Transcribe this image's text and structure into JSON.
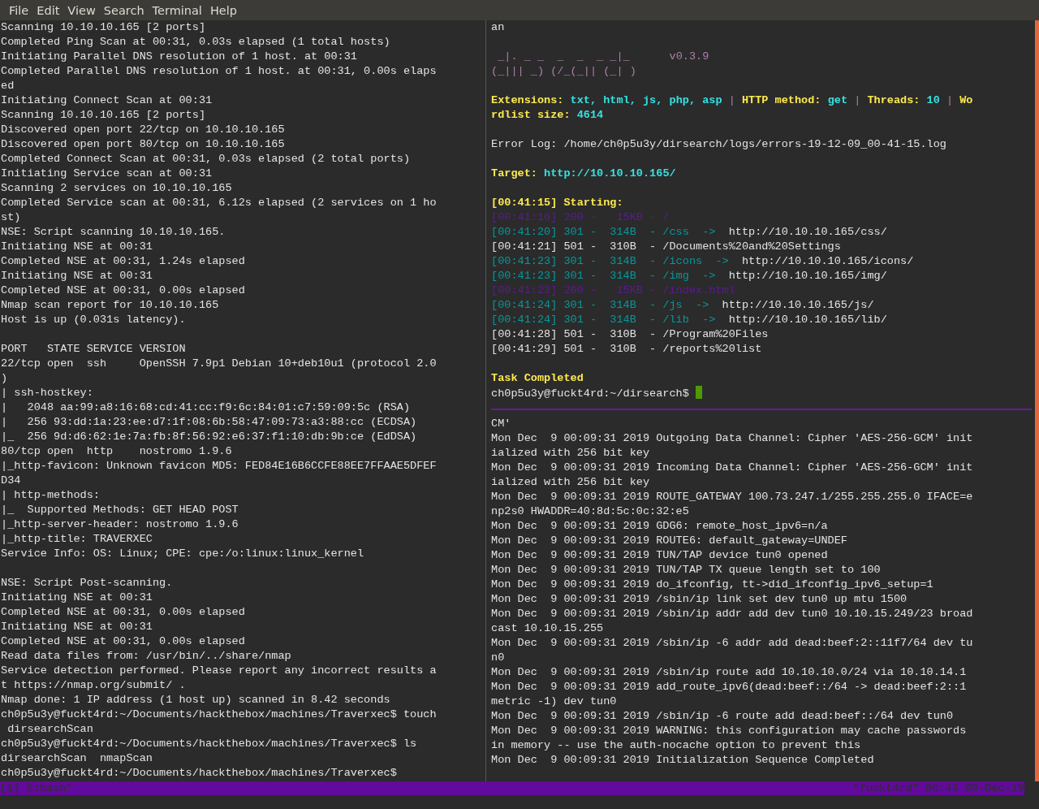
{
  "menu": [
    "File",
    "Edit",
    "View",
    "Search",
    "Terminal",
    "Help"
  ],
  "left_pane": {
    "lines": [
      [
        {
          "text": "Scanning 10.10.10.165 [2 ports]",
          "kind": "plain"
        }
      ],
      [
        {
          "text": "Completed Ping Scan at 00:31, 0.03s elapsed (1 total hosts)",
          "kind": "plain"
        }
      ],
      [
        {
          "text": "Initiating Parallel DNS resolution of 1 host. at 00:31",
          "kind": "plain"
        }
      ],
      [
        {
          "text": "Completed Parallel DNS resolution of 1 host. at 00:31, 0.00s elaps",
          "kind": "plain"
        }
      ],
      [
        {
          "text": "ed",
          "kind": "plain"
        }
      ],
      [
        {
          "text": "Initiating Connect Scan at 00:31",
          "kind": "plain"
        }
      ],
      [
        {
          "text": "Scanning 10.10.10.165 [2 ports]",
          "kind": "plain"
        }
      ],
      [
        {
          "text": "Discovered open port 22/tcp on 10.10.10.165",
          "kind": "plain"
        }
      ],
      [
        {
          "text": "Discovered open port 80/tcp on 10.10.10.165",
          "kind": "plain"
        }
      ],
      [
        {
          "text": "Completed Connect Scan at 00:31, 0.03s elapsed (2 total ports)",
          "kind": "plain"
        }
      ],
      [
        {
          "text": "Initiating Service scan at 00:31",
          "kind": "plain"
        }
      ],
      [
        {
          "text": "Scanning 2 services on 10.10.10.165",
          "kind": "plain"
        }
      ],
      [
        {
          "text": "Completed Service scan at 00:31, 6.12s elapsed (2 services on 1 ho",
          "kind": "plain"
        }
      ],
      [
        {
          "text": "st)",
          "kind": "plain"
        }
      ],
      [
        {
          "text": "NSE: Script scanning 10.10.10.165.",
          "kind": "plain"
        }
      ],
      [
        {
          "text": "Initiating NSE at 00:31",
          "kind": "plain"
        }
      ],
      [
        {
          "text": "Completed NSE at 00:31, 1.24s elapsed",
          "kind": "plain"
        }
      ],
      [
        {
          "text": "Initiating NSE at 00:31",
          "kind": "plain"
        }
      ],
      [
        {
          "text": "Completed NSE at 00:31, 0.00s elapsed",
          "kind": "plain"
        }
      ],
      [
        {
          "text": "Nmap scan report for 10.10.10.165",
          "kind": "plain"
        }
      ],
      [
        {
          "text": "Host is up (0.031s latency).",
          "kind": "plain"
        }
      ],
      {
        "kind": "blank"
      },
      [
        {
          "text": "PORT   STATE SERVICE VERSION",
          "kind": "plain"
        }
      ],
      [
        {
          "text": "22/tcp open  ssh     OpenSSH 7.9p1 Debian 10+deb10u1 (protocol 2.0",
          "kind": "plain"
        }
      ],
      [
        {
          "text": ")",
          "kind": "plain"
        }
      ],
      [
        {
          "text": "| ssh-hostkey:",
          "kind": "plain"
        }
      ],
      [
        {
          "text": "|   2048 aa:99:a8:16:68:cd:41:cc:f9:6c:84:01:c7:59:09:5c (RSA)",
          "kind": "plain"
        }
      ],
      [
        {
          "text": "|   256 93:dd:1a:23:ee:d7:1f:08:6b:58:47:09:73:a3:88:cc (ECDSA)",
          "kind": "plain"
        }
      ],
      [
        {
          "text": "|_  256 9d:d6:62:1e:7a:fb:8f:56:92:e6:37:f1:10:db:9b:ce (EdDSA)",
          "kind": "plain"
        }
      ],
      [
        {
          "text": "80/tcp open  http    nostromo 1.9.6",
          "kind": "plain"
        }
      ],
      [
        {
          "text": "|_http-favicon: Unknown favicon MD5: FED84E16B6CCFE88EE7FFAAE5DFEF",
          "kind": "plain"
        }
      ],
      [
        {
          "text": "D34",
          "kind": "plain"
        }
      ],
      [
        {
          "text": "| http-methods:",
          "kind": "plain"
        }
      ],
      [
        {
          "text": "|_  Supported Methods: GET HEAD POST",
          "kind": "plain"
        }
      ],
      [
        {
          "text": "|_http-server-header: nostromo 1.9.6",
          "kind": "plain"
        }
      ],
      [
        {
          "text": "|_http-title: TRAVERXEC",
          "kind": "plain"
        }
      ],
      [
        {
          "text": "Service Info: OS: Linux; CPE: cpe:/o:linux:linux_kernel",
          "kind": "plain"
        }
      ],
      {
        "kind": "blank"
      },
      [
        {
          "text": "NSE: Script Post-scanning.",
          "kind": "plain"
        }
      ],
      [
        {
          "text": "Initiating NSE at 00:31",
          "kind": "plain"
        }
      ],
      [
        {
          "text": "Completed NSE at 00:31, 0.00s elapsed",
          "kind": "plain"
        }
      ],
      [
        {
          "text": "Initiating NSE at 00:31",
          "kind": "plain"
        }
      ],
      [
        {
          "text": "Completed NSE at 00:31, 0.00s elapsed",
          "kind": "plain"
        }
      ],
      [
        {
          "text": "Read data files from: /usr/bin/../share/nmap",
          "kind": "plain"
        }
      ],
      [
        {
          "text": "Service detection performed. Please report any incorrect results a",
          "kind": "plain"
        }
      ],
      [
        {
          "text": "t https://nmap.org/submit/ .",
          "kind": "plain"
        }
      ],
      [
        {
          "text": "Nmap done: 1 IP address (1 host up) scanned in 8.42 seconds",
          "kind": "plain"
        }
      ],
      [
        {
          "text": "ch0p5u3y@fuckt4rd:~/Documents/hackthebox/machines/Traverxec$ touch",
          "kind": "plain"
        }
      ],
      [
        {
          "text": " dirsearchScan",
          "kind": "plain"
        }
      ],
      [
        {
          "text": "ch0p5u3y@fuckt4rd:~/Documents/hackthebox/machines/Traverxec$ ls",
          "kind": "plain"
        }
      ],
      [
        {
          "text": "dirsearchScan  nmapScan",
          "kind": "plain"
        }
      ],
      [
        {
          "text": "ch0p5u3y@fuckt4rd:~/Documents/hackthebox/machines/Traverxec$",
          "kind": "plain"
        }
      ]
    ]
  },
  "top_right_pane": {
    "lines": [
      [
        {
          "text": "an",
          "kind": "plain"
        }
      ],
      {
        "kind": "blank"
      },
      [
        {
          "text": " _|. _ _  _  _  _ _|_      ",
          "kind": "pink"
        },
        {
          "text": "v0.3.9",
          "kind": "pink"
        }
      ],
      [
        {
          "text": "(_||| _) (/_(_|| (_| )",
          "kind": "pink"
        }
      ],
      {
        "kind": "blank"
      },
      [
        {
          "text": "Extensions: ",
          "kind": "yellow"
        },
        {
          "text": "txt, html, js, php, asp",
          "kind": "cyan"
        },
        {
          "text": " | ",
          "kind": "pink"
        },
        {
          "text": "HTTP method: ",
          "kind": "yellow"
        },
        {
          "text": "get",
          "kind": "cyan"
        },
        {
          "text": " | ",
          "kind": "pink"
        },
        {
          "text": "Threads: ",
          "kind": "yellow"
        },
        {
          "text": "10",
          "kind": "cyan"
        },
        {
          "text": " | ",
          "kind": "pink"
        },
        {
          "text": "Wo",
          "kind": "yellow"
        }
      ],
      [
        {
          "text": "rdlist size: ",
          "kind": "yellow"
        },
        {
          "text": "4614",
          "kind": "cyan"
        }
      ],
      {
        "kind": "blank"
      },
      [
        {
          "text": "Error Log: /home/ch0p5u3y/dirsearch/logs/errors-19-12-09_00-41-15.log",
          "kind": "plain"
        }
      ],
      {
        "kind": "blank"
      },
      [
        {
          "text": "Target: ",
          "kind": "yellow"
        },
        {
          "text": "http://10.10.10.165/",
          "kind": "cyan"
        }
      ],
      {
        "kind": "blank"
      },
      [
        {
          "text": "[00:41:15] Starting: ",
          "kind": "yellow"
        }
      ],
      [
        {
          "text": "[00:41:16] 200 -   15KB - /",
          "kind": "purple"
        }
      ],
      [
        {
          "text": "[00:41:20] 301 -  314B  - /css  ->  ",
          "kind": "teal"
        },
        {
          "text": "http://10.10.10.165/css/",
          "kind": "plain"
        }
      ],
      [
        {
          "text": "[00:41:21] 501 -  310B  - /Documents%20and%20Settings",
          "kind": "plain"
        }
      ],
      [
        {
          "text": "[00:41:23] 301 -  314B  - /icons  ->  ",
          "kind": "teal"
        },
        {
          "text": "http://10.10.10.165/icons/",
          "kind": "plain"
        }
      ],
      [
        {
          "text": "[00:41:23] 301 -  314B  - /img  ->  ",
          "kind": "teal"
        },
        {
          "text": "http://10.10.10.165/img/",
          "kind": "plain"
        }
      ],
      [
        {
          "text": "[00:41:23] 200 -   15KB - /index.html",
          "kind": "purple"
        }
      ],
      [
        {
          "text": "[00:41:24] 301 -  314B  - /js  ->  ",
          "kind": "teal"
        },
        {
          "text": "http://10.10.10.165/js/",
          "kind": "plain"
        }
      ],
      [
        {
          "text": "[00:41:24] 301 -  314B  - /lib  ->  ",
          "kind": "teal"
        },
        {
          "text": "http://10.10.10.165/lib/",
          "kind": "plain"
        }
      ],
      [
        {
          "text": "[00:41:28] 501 -  310B  - /Program%20Files",
          "kind": "plain"
        }
      ],
      [
        {
          "text": "[00:41:29] 501 -  310B  - /reports%20list",
          "kind": "plain"
        }
      ],
      {
        "kind": "blank"
      },
      [
        {
          "text": "Task Completed",
          "kind": "yellow"
        }
      ],
      {
        "kind": "prompt",
        "cursor": true,
        "segments": [
          {
            "text": "ch0p5u3y@fuckt4rd:~/dirsearch$ ",
            "kind": "plain"
          }
        ]
      }
    ]
  },
  "bottom_right_pane": {
    "lines": [
      [
        {
          "text": "CM'",
          "kind": "plain"
        }
      ],
      [
        {
          "text": "Mon Dec  9 00:09:31 2019 Outgoing Data Channel: Cipher 'AES-256-GCM' init",
          "kind": "plain"
        }
      ],
      [
        {
          "text": "ialized with 256 bit key",
          "kind": "plain"
        }
      ],
      [
        {
          "text": "Mon Dec  9 00:09:31 2019 Incoming Data Channel: Cipher 'AES-256-GCM' init",
          "kind": "plain"
        }
      ],
      [
        {
          "text": "ialized with 256 bit key",
          "kind": "plain"
        }
      ],
      [
        {
          "text": "Mon Dec  9 00:09:31 2019 ROUTE_GATEWAY 100.73.247.1/255.255.255.0 IFACE=e",
          "kind": "plain"
        }
      ],
      [
        {
          "text": "np2s0 HWADDR=40:8d:5c:0c:32:e5",
          "kind": "plain"
        }
      ],
      [
        {
          "text": "Mon Dec  9 00:09:31 2019 GDG6: remote_host_ipv6=n/a",
          "kind": "plain"
        }
      ],
      [
        {
          "text": "Mon Dec  9 00:09:31 2019 ROUTE6: default_gateway=UNDEF",
          "kind": "plain"
        }
      ],
      [
        {
          "text": "Mon Dec  9 00:09:31 2019 TUN/TAP device tun0 opened",
          "kind": "plain"
        }
      ],
      [
        {
          "text": "Mon Dec  9 00:09:31 2019 TUN/TAP TX queue length set to 100",
          "kind": "plain"
        }
      ],
      [
        {
          "text": "Mon Dec  9 00:09:31 2019 do_ifconfig, tt->did_ifconfig_ipv6_setup=1",
          "kind": "plain"
        }
      ],
      [
        {
          "text": "Mon Dec  9 00:09:31 2019 /sbin/ip link set dev tun0 up mtu 1500",
          "kind": "plain"
        }
      ],
      [
        {
          "text": "Mon Dec  9 00:09:31 2019 /sbin/ip addr add dev tun0 10.10.15.249/23 broad",
          "kind": "plain"
        }
      ],
      [
        {
          "text": "cast 10.10.15.255",
          "kind": "plain"
        }
      ],
      [
        {
          "text": "Mon Dec  9 00:09:31 2019 /sbin/ip -6 addr add dead:beef:2::11f7/64 dev tu",
          "kind": "plain"
        }
      ],
      [
        {
          "text": "n0",
          "kind": "plain"
        }
      ],
      [
        {
          "text": "Mon Dec  9 00:09:31 2019 /sbin/ip route add 10.10.10.0/24 via 10.10.14.1",
          "kind": "plain"
        }
      ],
      [
        {
          "text": "Mon Dec  9 00:09:31 2019 add_route_ipv6(dead:beef::/64 -> dead:beef:2::1",
          "kind": "plain"
        }
      ],
      [
        {
          "text": "metric -1) dev tun0",
          "kind": "plain"
        }
      ],
      [
        {
          "text": "Mon Dec  9 00:09:31 2019 /sbin/ip -6 route add dead:beef::/64 dev tun0",
          "kind": "plain"
        }
      ],
      [
        {
          "text": "Mon Dec  9 00:09:31 2019 WARNING: this configuration may cache passwords",
          "kind": "plain"
        }
      ],
      [
        {
          "text": "in memory -- use the auth-nocache option to prevent this",
          "kind": "plain"
        }
      ],
      [
        {
          "text": "Mon Dec  9 00:09:31 2019 Initialization Sequence Completed",
          "kind": "plain"
        }
      ]
    ]
  },
  "status_bar": {
    "left": "[1] 0:bash*",
    "right": "\"fuckt4rd\" 00:43 09-Dec-19"
  }
}
